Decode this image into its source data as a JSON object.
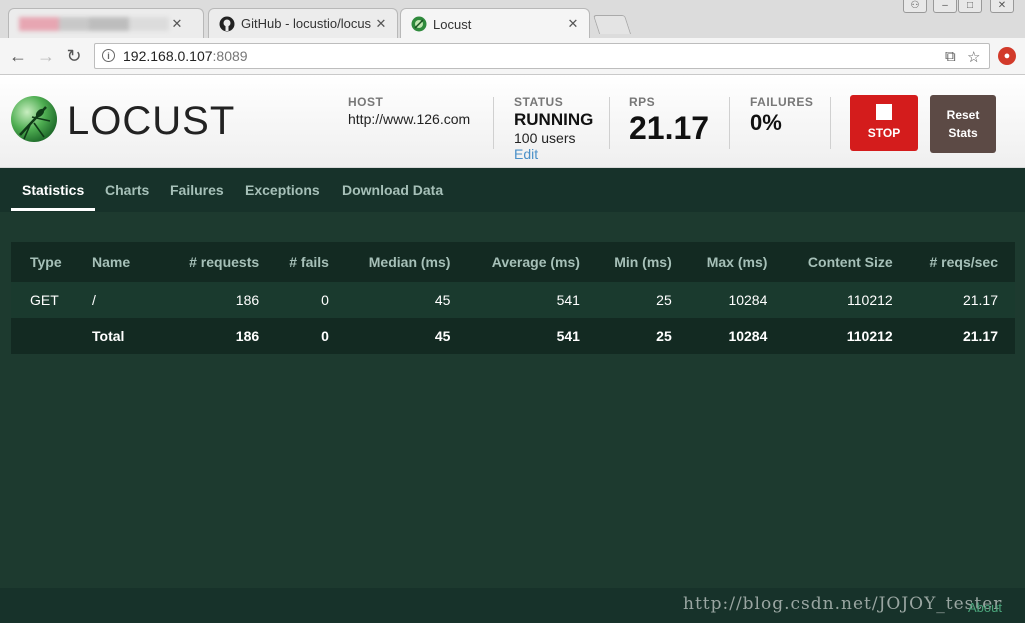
{
  "browser": {
    "tabs": [
      {
        "title": "",
        "active": false
      },
      {
        "title": "GitHub - locustio/locus",
        "active": false
      },
      {
        "title": "Locust",
        "active": true
      }
    ],
    "url_host": "192.168.0.107",
    "url_port": ":8089"
  },
  "header": {
    "logo_text": "LOCUST",
    "host_label": "HOST",
    "host_value": "http://www.126.com",
    "status_label": "STATUS",
    "status_value": "RUNNING",
    "users": "100 users",
    "edit_label": "Edit",
    "rps_label": "RPS",
    "rps_value": "21.17",
    "failures_label": "FAILURES",
    "failures_value": "0%",
    "stop_label": "STOP",
    "reset_label_1": "Reset",
    "reset_label_2": "Stats"
  },
  "nav": {
    "items": [
      "Statistics",
      "Charts",
      "Failures",
      "Exceptions",
      "Download Data"
    ]
  },
  "table": {
    "headers": [
      "Type",
      "Name",
      "# requests",
      "# fails",
      "Median (ms)",
      "Average (ms)",
      "Min (ms)",
      "Max (ms)",
      "Content Size",
      "# reqs/sec"
    ],
    "rows": [
      [
        "GET",
        "/",
        "186",
        "0",
        "45",
        "541",
        "25",
        "10284",
        "110212",
        "21.17"
      ]
    ],
    "total": [
      "",
      "Total",
      "186",
      "0",
      "45",
      "541",
      "25",
      "10284",
      "110212",
      "21.17"
    ]
  },
  "footer": {
    "about": "About",
    "watermark": "http://blog.csdn.net/JOJOY_tester"
  },
  "colors": {
    "stop": "#d41c1c",
    "reset": "#5c4a45",
    "background": "#1d3a2f"
  }
}
